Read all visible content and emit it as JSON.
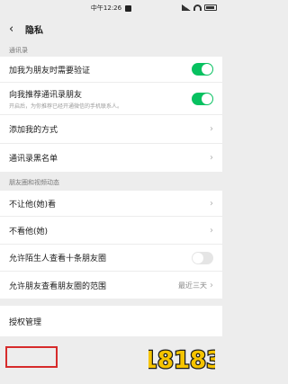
{
  "status": {
    "time": "中午12:26"
  },
  "nav": {
    "title": "隐私"
  },
  "sections": {
    "contacts": "通讯录",
    "moments": "朋友圈和视频动态"
  },
  "rows": {
    "verify": "加我为朋友时需要验证",
    "recommend": "向我推荐通讯录朋友",
    "recommend_sub": "开启后，为你推荐已经开通微信的手机联系人。",
    "add_method": "添加我的方式",
    "blacklist": "通讯录黑名单",
    "hide_from": "不让他(她)看",
    "dont_see": "不看他(她)",
    "stranger_view": "允许陌生人查看十条朋友圈",
    "friend_range": "允许朋友查看朋友圈的范围",
    "friend_range_value": "最近三天",
    "auth": "授权管理"
  },
  "toggles": {
    "verify": true,
    "recommend": true,
    "stranger_view": false
  },
  "watermark": {
    "text": "18183"
  },
  "colors": {
    "accent": "#07c160",
    "highlight_box": "#d62b2b"
  }
}
